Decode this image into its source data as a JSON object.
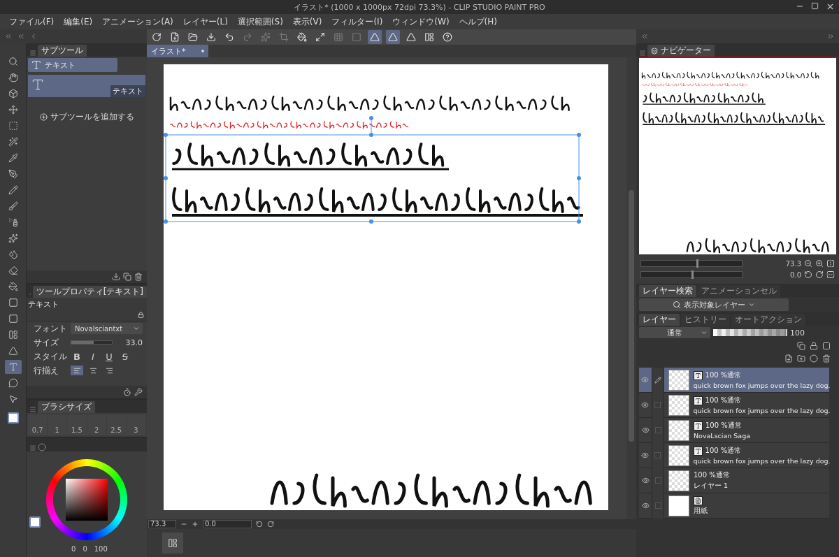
{
  "window": {
    "title": "イラスト* (1000 x 1000px 72dpi 73.3%)  - CLIP STUDIO PAINT PRO"
  },
  "menu": [
    "ファイル(F)",
    "編集(E)",
    "アニメーション(A)",
    "レイヤー(L)",
    "選択範囲(S)",
    "表示(V)",
    "フィルター(I)",
    "ウィンドウ(W)",
    "ヘルプ(H)"
  ],
  "tools": [
    {
      "kind": "zoom",
      "selected": false
    },
    {
      "kind": "hand",
      "selected": false
    },
    {
      "kind": "object",
      "selected": false
    },
    {
      "kind": "move",
      "selected": false
    },
    {
      "kind": "marquee",
      "selected": false
    },
    {
      "kind": "wand",
      "selected": false
    },
    {
      "kind": "eyedropper",
      "selected": false
    },
    {
      "kind": "pen",
      "selected": false
    },
    {
      "kind": "pencil",
      "selected": false
    },
    {
      "kind": "brush",
      "selected": false
    },
    {
      "kind": "airbrush",
      "selected": false
    },
    {
      "kind": "decoration",
      "selected": false
    },
    {
      "kind": "blend",
      "selected": false
    },
    {
      "kind": "eraser",
      "selected": false
    },
    {
      "kind": "fill",
      "selected": false
    },
    {
      "kind": "gradient",
      "selected": false
    },
    {
      "kind": "figure",
      "selected": false
    },
    {
      "kind": "frame",
      "selected": false
    },
    {
      "kind": "ruler",
      "selected": false
    },
    {
      "kind": "text",
      "selected": true
    },
    {
      "kind": "balloon",
      "selected": false
    },
    {
      "kind": "correct",
      "selected": false
    }
  ],
  "subtool": {
    "tab": "サブツール",
    "groups": [
      {
        "label": "テキスト",
        "selected": true
      }
    ],
    "preset": "テキスト",
    "add": "サブツールを追加する"
  },
  "tool_property": {
    "tab": "ツールプロパティ[テキスト]",
    "preset": "テキスト",
    "font_label": "フォント",
    "font": "Novalsciantxt",
    "size_label": "サイズ",
    "size": "33.0",
    "size_slider": {
      "level": 0.55
    },
    "style_label": "スタイル",
    "styles": [
      {
        "label": "B",
        "kind": "bold"
      },
      {
        "label": "I",
        "kind": "italic"
      },
      {
        "label": "U",
        "kind": "underline"
      },
      {
        "label": "S",
        "kind": "strike"
      }
    ],
    "align_label": "行揃え",
    "aligns": [
      {
        "kind": "left",
        "selected": true
      },
      {
        "kind": "center",
        "selected": false
      },
      {
        "kind": "right",
        "selected": false
      }
    ]
  },
  "brush_size": {
    "tab": "ブラシサイズ",
    "sizes": [
      "0.7",
      "1",
      "1.5",
      "2",
      "2.5",
      "3"
    ]
  },
  "color": {
    "values": [
      "0",
      "0",
      "100"
    ]
  },
  "canvas_tab": {
    "label": "イラスト*"
  },
  "status": {
    "zoom": "73.3",
    "angle": "0.0"
  },
  "navigator": {
    "tab": "ナビゲーター",
    "zoom_slider": {
      "level": 0.55
    },
    "zoom": "73.3",
    "rotate_slider": {
      "level": 0.5
    },
    "angle": "0.0"
  },
  "layer_search": {
    "tabs": [
      {
        "label": "レイヤー検索",
        "selected": true
      },
      {
        "label": "アニメーションセル",
        "selected": false
      }
    ],
    "filter": "表示対象レイヤー"
  },
  "layer_panel": {
    "tabs": [
      {
        "label": "レイヤー",
        "selected": true
      },
      {
        "label": "ヒストリー",
        "selected": false
      },
      {
        "label": "オートアクション",
        "selected": false
      }
    ],
    "blend": "通常",
    "opacity_slider": {
      "level": 1.0
    },
    "opacity": "100",
    "layers": [
      {
        "kind": "text",
        "mode": "100 %通常",
        "name": "quick brown fox jumps over the lazy dog.",
        "selected": true,
        "visible": true
      },
      {
        "kind": "text",
        "mode": "100 %通常",
        "name": "quick brown fox jumps over the lazy dog.",
        "selected": false,
        "visible": true
      },
      {
        "kind": "text",
        "mode": "100 %通常",
        "name": "NovaLscian Saga",
        "selected": false,
        "visible": true
      },
      {
        "kind": "text",
        "mode": "100 %通常",
        "name": "quick brown fox jumps over the lazy dog.",
        "selected": false,
        "visible": true
      },
      {
        "kind": "raster",
        "mode": "100 %通常",
        "name": "レイヤー 1",
        "selected": false,
        "visible": true
      },
      {
        "kind": "paper",
        "name": "用紙",
        "selected": false,
        "visible": true
      }
    ]
  }
}
